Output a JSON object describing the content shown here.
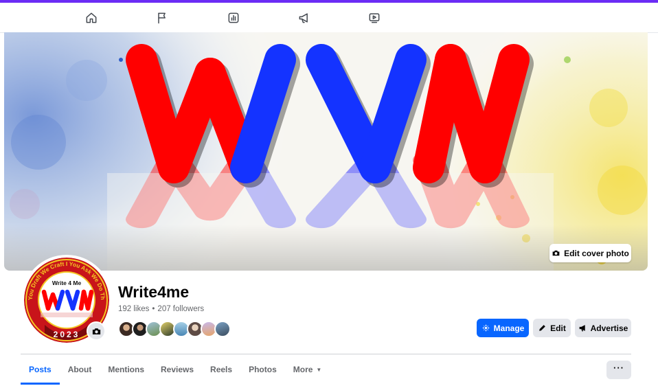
{
  "topnav": {
    "items": [
      {
        "icon": "home-icon"
      },
      {
        "icon": "flag-icon"
      },
      {
        "icon": "insights-icon"
      },
      {
        "icon": "megaphone-icon"
      },
      {
        "icon": "video-icon"
      }
    ]
  },
  "cover": {
    "logo_text": "WVM",
    "edit_label": "Edit cover photo"
  },
  "avatar": {
    "top_text": "Write 4 Me",
    "logo_text": "WVM",
    "ring_text": "You Draft We Craft I You Ask We Do The Task",
    "year": "2023"
  },
  "page": {
    "name": "Write4me",
    "likes": "192 likes",
    "separator": "•",
    "followers": "207 followers"
  },
  "actions": {
    "manage": "Manage",
    "edit": "Edit",
    "advertise": "Advertise"
  },
  "tabs": [
    {
      "label": "Posts",
      "active": true
    },
    {
      "label": "About"
    },
    {
      "label": "Mentions"
    },
    {
      "label": "Reviews"
    },
    {
      "label": "Reels"
    },
    {
      "label": "Photos"
    },
    {
      "label": "More",
      "caret": "▼"
    }
  ],
  "more_menu": "···",
  "colors": {
    "accent": "#0866ff",
    "brand_red": "#ff0000",
    "brand_blue": "#1433ff"
  }
}
